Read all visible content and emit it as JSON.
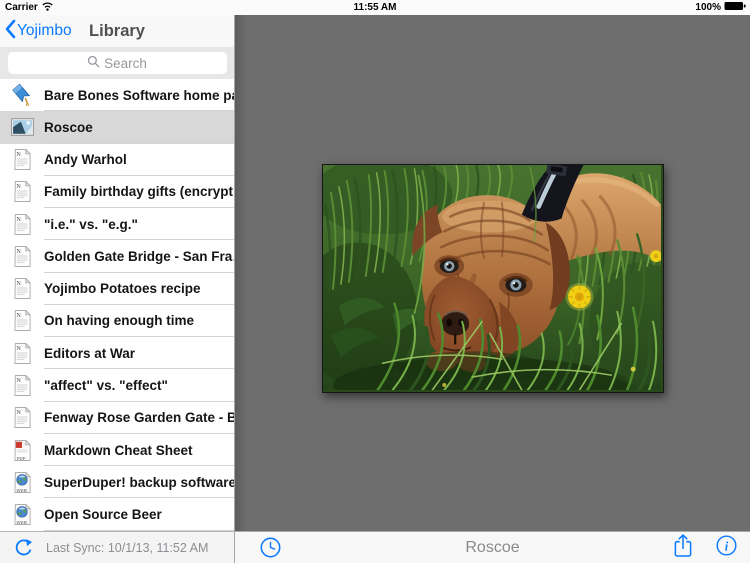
{
  "status_bar": {
    "carrier": "Carrier",
    "time": "11:55 AM",
    "battery_percent": "100%"
  },
  "sidebar": {
    "back_label": "Yojimbo",
    "title": "Library",
    "search": {
      "placeholder": "Search"
    },
    "items": [
      {
        "icon": "bookmark",
        "label": "Bare Bones Software home pa…",
        "selected": false
      },
      {
        "icon": "image",
        "label": "Roscoe",
        "selected": true
      },
      {
        "icon": "note",
        "label": "Andy Warhol",
        "selected": false
      },
      {
        "icon": "note",
        "label": "Family birthday gifts (encrypt…",
        "selected": false
      },
      {
        "icon": "note",
        "label": "\"i.e.\" vs. \"e.g.\"",
        "selected": false
      },
      {
        "icon": "note",
        "label": "Golden Gate Bridge - San Fra…",
        "selected": false
      },
      {
        "icon": "note",
        "label": "Yojimbo Potatoes recipe",
        "selected": false
      },
      {
        "icon": "note",
        "label": "On having enough time",
        "selected": false
      },
      {
        "icon": "note",
        "label": "Editors at War",
        "selected": false
      },
      {
        "icon": "note",
        "label": "\"affect\" vs. \"effect\"",
        "selected": false
      },
      {
        "icon": "note",
        "label": "Fenway Rose Garden Gate - B…",
        "selected": false
      },
      {
        "icon": "pdf",
        "label": "Markdown Cheat Sheet",
        "selected": false
      },
      {
        "icon": "web",
        "label": "SuperDuper! backup software",
        "selected": false
      },
      {
        "icon": "web",
        "label": "Open Source Beer",
        "selected": false
      }
    ],
    "footer": {
      "last_sync": "Last Sync: 10/1/13, 11:52 AM"
    }
  },
  "content": {
    "toolbar": {
      "title": "Roscoe"
    },
    "photo": {
      "subject": "Brown puppy lying in green grass beside a yellow dandelion, wearing a dark collar"
    }
  },
  "colors": {
    "accent_blue": "#0a7aff",
    "selection_gray": "#d8d8d8",
    "canvas_gray": "#6e6e6e"
  }
}
